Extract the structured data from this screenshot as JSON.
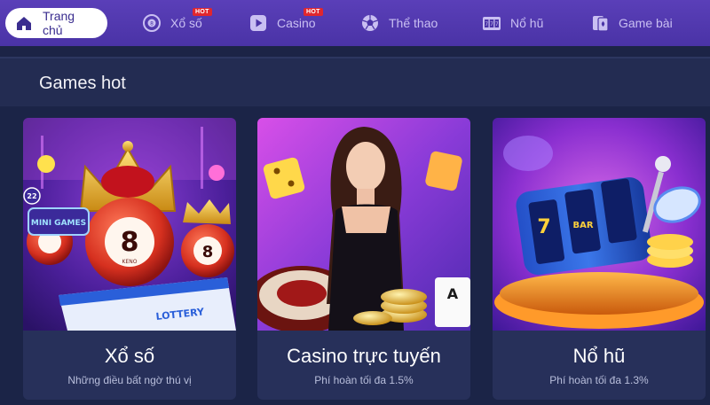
{
  "nav": {
    "items": [
      {
        "label": "Trang chủ",
        "icon": "home-icon",
        "active": true
      },
      {
        "label": "Xổ số",
        "icon": "lottery-ball-icon",
        "badge": "HOT"
      },
      {
        "label": "Casino",
        "icon": "play-icon",
        "badge": "HOT"
      },
      {
        "label": "Thể thao",
        "icon": "soccer-ball-icon"
      },
      {
        "label": "Nổ hũ",
        "icon": "slot-machine-icon"
      },
      {
        "label": "Game bài",
        "icon": "playing-cards-icon"
      }
    ]
  },
  "section": {
    "title": "Games hot"
  },
  "cards": [
    {
      "title": "Xổ số",
      "subtitle": "Những điều bất ngờ thú vị",
      "art_texts": [
        "MINI GAMES",
        "22",
        "KENO",
        "8",
        "LOTTERY"
      ]
    },
    {
      "title": "Casino trực tuyến",
      "subtitle": "Phí hoàn tối đa 1.5%",
      "art_texts": [
        "A"
      ]
    },
    {
      "title": "Nổ hũ",
      "subtitle": "Phí hoàn tối đa 1.3%",
      "art_texts": [
        "7",
        "BAR"
      ]
    }
  ],
  "colors": {
    "nav_bg": "#4f38ae",
    "page_bg": "#1c2446",
    "card_bg": "#27305a",
    "hot_badge": "#e1262d",
    "active_text": "#3a2d8f"
  }
}
